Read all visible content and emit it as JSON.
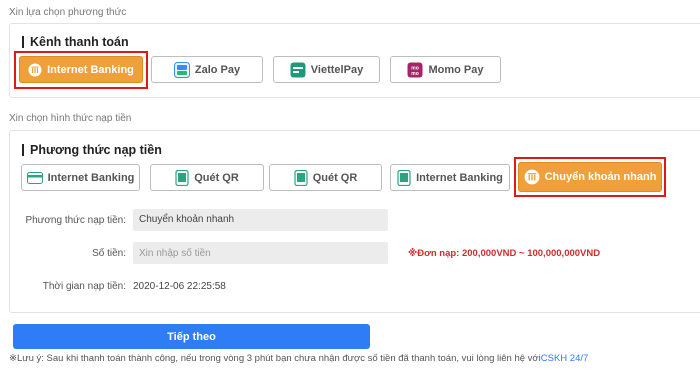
{
  "channel_section": {
    "caption": "Xin lựa chọn phương thức",
    "title": "Kênh thanh toán",
    "options": [
      {
        "label": "Internet Banking",
        "icon": "bank-icon",
        "active": true
      },
      {
        "label": "Zalo Pay",
        "icon": "zalo-pay-icon",
        "active": false
      },
      {
        "label": "ViettelPay",
        "icon": "viettel-pay-icon",
        "active": false
      },
      {
        "label": "Momo Pay",
        "icon": "momo-icon",
        "active": false
      }
    ]
  },
  "method_section": {
    "caption": "Xin chọn hình thức nạp tiền",
    "title": "Phương thức nạp tiền",
    "options": [
      {
        "label": "Internet Banking",
        "icon": "card-icon",
        "active": false
      },
      {
        "label": "Quét QR",
        "icon": "phone-icon",
        "active": false
      },
      {
        "label": "Quét QR",
        "icon": "phone-icon",
        "active": false
      },
      {
        "label": "Internet Banking",
        "icon": "phone-icon",
        "active": false
      },
      {
        "label": "Chuyển khoản nhanh",
        "icon": "bank-icon",
        "active": true
      }
    ]
  },
  "form": {
    "method_label": "Phương thức nạp tiền:",
    "method_value": "Chuyển khoản nhanh",
    "amount_label": "Số tiền:",
    "amount_placeholder": "Xin nhập số tiền",
    "limit_text": "※Đơn nạp: 200,000VND ~ 100,000,000VND",
    "time_label": "Thời gian nạp tiền:",
    "time_value": "2020-12-06 22:25:58"
  },
  "submit_label": "Tiếp theo",
  "note": {
    "text": "※Lưu ý: Sau khi thanh toán thành công, nếu trong vòng 3 phút bạn chưa nhận được số tiền đã thanh toán, vui lòng liên hệ với",
    "link": "CSKH 24/7"
  },
  "colors": {
    "active": "#f0a03a",
    "highlight": "#e01818",
    "primary": "#2e7cf6",
    "limit": "#d42a2a"
  }
}
